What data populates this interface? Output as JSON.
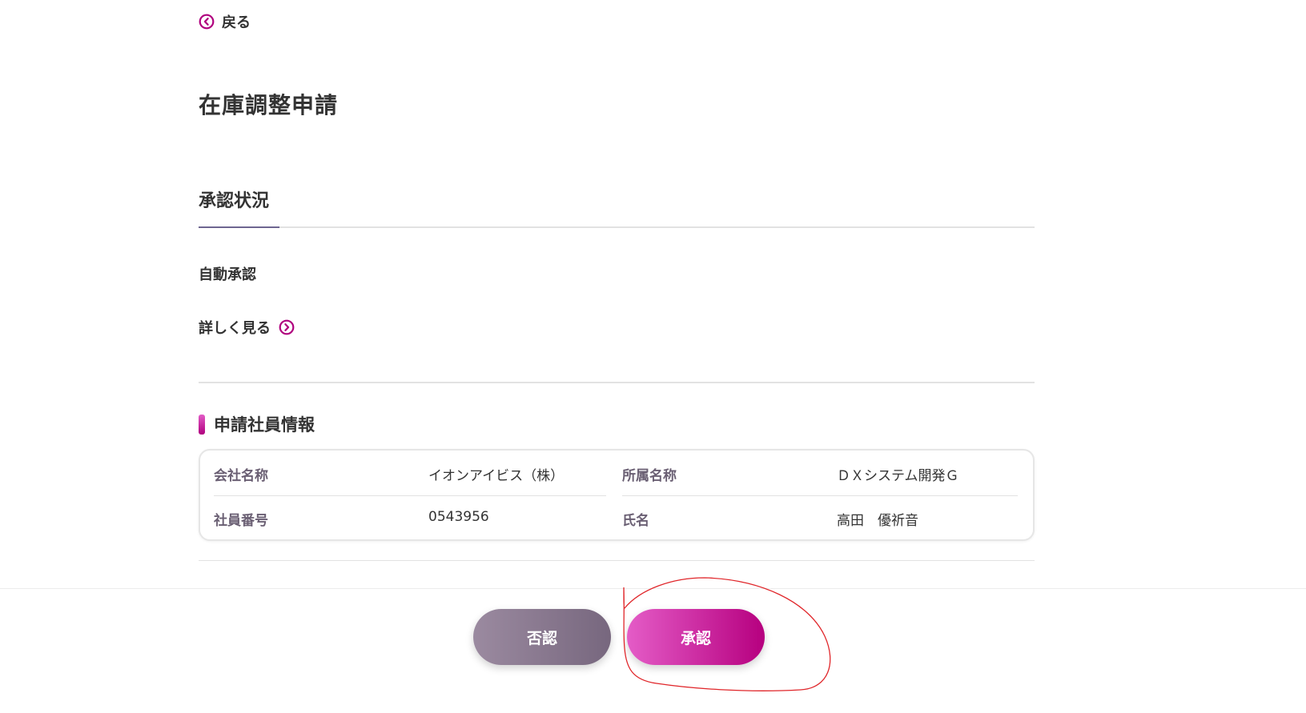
{
  "navigation": {
    "back_label": "戻る"
  },
  "page": {
    "title": "在庫調整申請"
  },
  "approval": {
    "tab_label": "承認状況",
    "status_text": "自動承認",
    "detail_link_label": "詳しく見る"
  },
  "employee_info": {
    "section_title": "申請社員情報",
    "rows": [
      {
        "label_left": "会社名称",
        "value_left": "イオンアイビス（株）",
        "label_right": "所属名称",
        "value_right": "ＤＸシステム開発Ｇ"
      },
      {
        "label_left": "社員番号",
        "value_left": "0543956",
        "label_right": "氏名",
        "value_right": "高田　優祈音"
      }
    ]
  },
  "actions": {
    "reject_label": "否認",
    "approve_label": "承認"
  },
  "icons": {
    "back": "chevron-left-circle-icon",
    "detail": "chevron-right-circle-icon"
  },
  "colors": {
    "accent": "#b0007e",
    "accent_light": "#e25cc6",
    "reject_start": "#9b8aa0",
    "reject_end": "#77677e",
    "annotation": "#e0262a"
  }
}
